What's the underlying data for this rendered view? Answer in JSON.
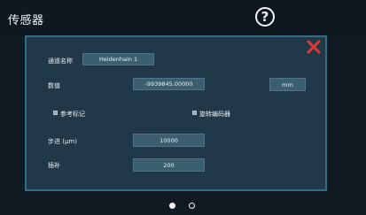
{
  "header": {
    "title": "传感器",
    "help_glyph": "?"
  },
  "panel": {
    "channel_label": "通道名称",
    "channel_value": "Heidenhain 1",
    "value_label": "数值",
    "value_display": "-9939845.00000",
    "unit_button": "mm",
    "ref_mark_label": "参考标记",
    "rotary_encoder_label": "旋转编码器",
    "step_label": "步进 (μm)",
    "step_value": "10000",
    "interp_label": "插补",
    "interp_value": "200"
  },
  "pagination": {
    "current": 1,
    "total": 2
  },
  "colors": {
    "close": "#e53935",
    "panel_border": "#2f6f86",
    "field": "#3c5f70"
  }
}
